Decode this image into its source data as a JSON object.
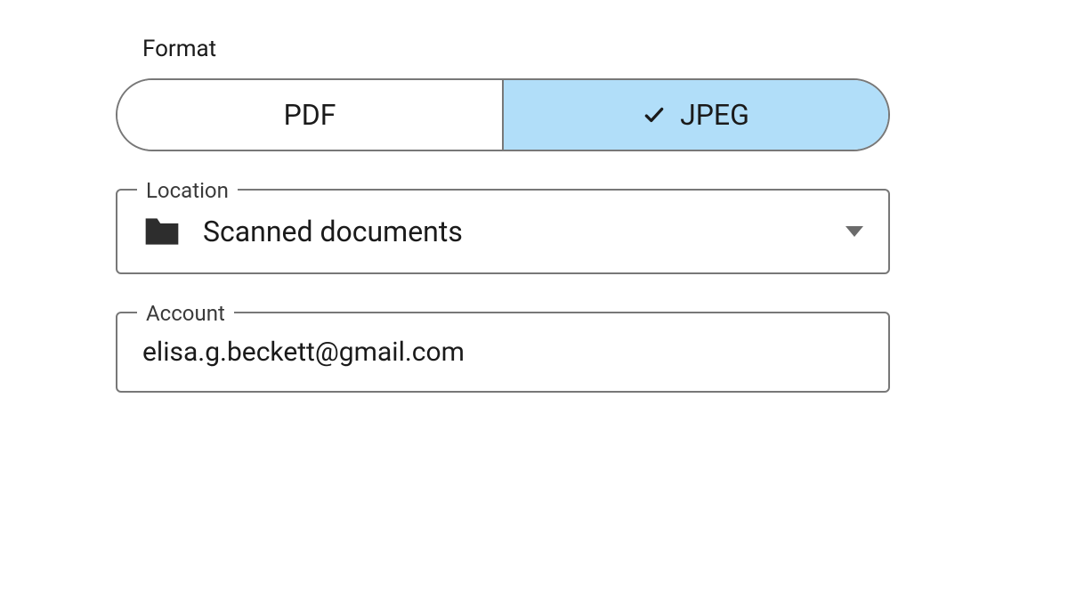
{
  "format": {
    "label": "Format",
    "options": {
      "pdf": "PDF",
      "jpeg": "JPEG"
    },
    "selected": "jpeg"
  },
  "location": {
    "label": "Location",
    "value": "Scanned documents"
  },
  "account": {
    "label": "Account",
    "value": "elisa.g.beckett@gmail.com"
  }
}
